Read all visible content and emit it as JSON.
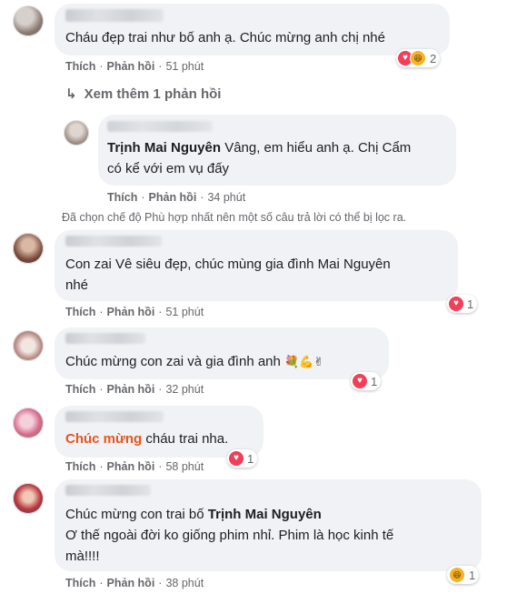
{
  "comments": [
    {
      "text": "Cháu đẹp trai như bố anh ạ. Chúc mừng anh chị nhé",
      "like": "Thích",
      "reply": "Phản hồi",
      "time": "51 phút",
      "reaction_count": "2",
      "reactions": [
        "heart",
        "haha"
      ]
    },
    {
      "view_more": "Xem thêm 1 phản hồi"
    },
    {
      "mention": "Trịnh Mai Nguyên",
      "text_line1": "Vâng, em hiểu anh ạ. Chị Cẩm",
      "text_line2": "có kể với em vụ đấy",
      "like": "Thích",
      "reply": "Phản hồi",
      "time": "34 phút"
    },
    {
      "notice": "Đã chọn chế độ Phù hợp nhất nên một số câu trả lời có thể bị lọc ra."
    },
    {
      "text_line1": "Con zai Vê siêu đẹp, chúc mùng gia đình Mai Nguyên",
      "text_line2": "nhé",
      "like": "Thích",
      "reply": "Phản hồi",
      "time": "51 phút",
      "reaction_count": "1",
      "reactions": [
        "heart"
      ]
    },
    {
      "text": "Chúc mừng con zai và gia đình anh",
      "like": "Thích",
      "reply": "Phản hồi",
      "time": "32 phút",
      "reaction_count": "1",
      "reactions": [
        "heart"
      ],
      "emojis": [
        "bouquet-emoji",
        "flexed-arm-emoji",
        "victory-hand-emoji"
      ]
    },
    {
      "highlight": "Chúc mừng",
      "text": "cháu trai nha.",
      "like": "Thích",
      "reply": "Phản hồi",
      "time": "58 phút",
      "reaction_count": "1",
      "reactions": [
        "heart"
      ]
    },
    {
      "name": "Huyền Thanh",
      "line1_prefix": "Chúc mừng con trai bố",
      "mention": "Trịnh Mai Nguyên",
      "line2": "Ơ thế ngoài đời ko giống phim nhỉ. Phim là học kinh tế",
      "line3": "mà!!!!",
      "like": "Thích",
      "reply": "Phản hồi",
      "time": "38 phút",
      "reaction_count": "1",
      "reactions": [
        "haha"
      ]
    }
  ],
  "reply_partial_name": "Cao Đức Trung",
  "colors": {
    "bubble": "#f0f2f5",
    "meta": "#65676b",
    "heart": "#f33e58",
    "haha": "#f7b125",
    "highlight": "#e8541e"
  }
}
